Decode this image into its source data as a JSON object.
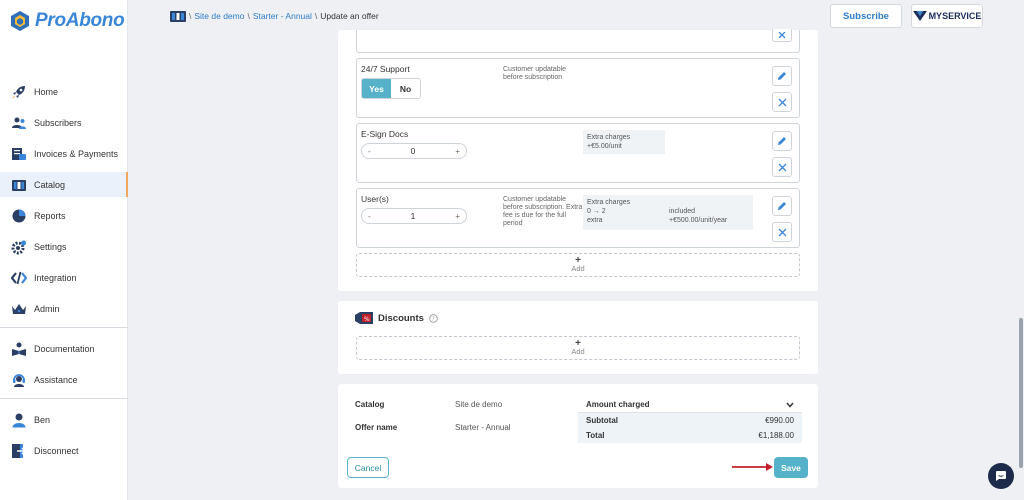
{
  "brand": {
    "name": "ProAbono"
  },
  "sidebar": {
    "items": [
      {
        "label": "Home",
        "icon": "rocket-icon"
      },
      {
        "label": "Subscribers",
        "icon": "users-icon"
      },
      {
        "label": "Invoices & Payments",
        "icon": "invoices-icon"
      },
      {
        "label": "Catalog",
        "icon": "catalog-icon",
        "active": true
      },
      {
        "label": "Reports",
        "icon": "pie-chart-icon"
      },
      {
        "label": "Settings",
        "icon": "gear-icon"
      },
      {
        "label": "Integration",
        "icon": "code-icon"
      },
      {
        "label": "Admin",
        "icon": "crown-icon"
      }
    ],
    "secondary": [
      {
        "label": "Documentation",
        "icon": "book-icon"
      },
      {
        "label": "Assistance",
        "icon": "headset-icon"
      }
    ],
    "user": [
      {
        "label": "Ben",
        "icon": "user-icon"
      },
      {
        "label": "Disconnect",
        "icon": "logout-icon"
      }
    ]
  },
  "header": {
    "breadcrumb": {
      "site": "Site de demo",
      "offer": "Starter - Annual",
      "current": "Update an offer",
      "separator": "\\"
    },
    "subscribe_label": "Subscribe",
    "partner_label": "MYSERVICE"
  },
  "features": {
    "support": {
      "name": "24/7 Support",
      "note": "Customer updatable before subscription",
      "yes": "Yes",
      "no": "No"
    },
    "esign": {
      "name": "E-Sign Docs",
      "value": "0",
      "minus": "-",
      "plus": "+",
      "charges_title": "Extra charges",
      "charges_line": "+€5.00/unit"
    },
    "users": {
      "name": "User(s)",
      "value": "1",
      "minus": "-",
      "plus": "+",
      "note": "Customer updatable before subscription. Extra fee is due for the full period",
      "charges_title": "Extra charges",
      "rows": [
        {
          "range": "0 → 2",
          "price": "included"
        },
        {
          "range": "extra",
          "price": "+€500.00/unit/year"
        }
      ]
    },
    "add_label": "Add",
    "add_plus": "+"
  },
  "discounts": {
    "title": "Discounts",
    "add_label": "Add",
    "add_plus": "+"
  },
  "summary": {
    "catalog_label": "Catalog",
    "catalog_value": "Site de demo",
    "offer_label": "Offer name",
    "offer_value": "Starter - Annual",
    "amount_title": "Amount charged",
    "subtotal_label": "Subtotal",
    "subtotal_value": "€990.00",
    "total_label": "Total",
    "total_value": "€1,188.00"
  },
  "actions": {
    "cancel_label": "Cancel",
    "save_label": "Save"
  },
  "colors": {
    "accent": "#55b2c9",
    "link": "#2f7cc9",
    "brand": "#3a86d8",
    "arrow": "#c0202a"
  }
}
